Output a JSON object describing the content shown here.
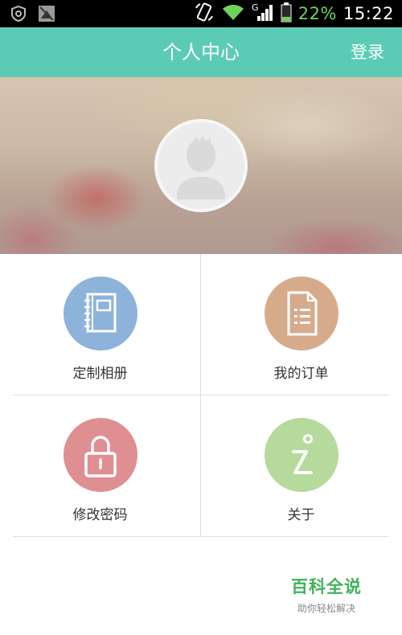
{
  "status_bar": {
    "network_type": "G",
    "battery_percent": "22%",
    "time": "15:22"
  },
  "header": {
    "title": "个人中心",
    "login_label": "登录"
  },
  "profile": {
    "avatar_icon": "default-user-avatar-icon"
  },
  "menu": {
    "items": [
      {
        "label": "定制相册",
        "icon": "notebook-icon",
        "color": "#8db3db"
      },
      {
        "label": "我的订单",
        "icon": "document-icon",
        "color": "#d6ab8c"
      },
      {
        "label": "修改密码",
        "icon": "lock-icon",
        "color": "#df8f92"
      },
      {
        "label": "关于",
        "icon": "info-icon",
        "color": "#b5da9b"
      }
    ]
  },
  "watermark": {
    "title": "百科全说",
    "subtitle": "助你轻松解决"
  },
  "colors": {
    "accent": "#5ccbb6",
    "divider": "#dcdcdc"
  }
}
